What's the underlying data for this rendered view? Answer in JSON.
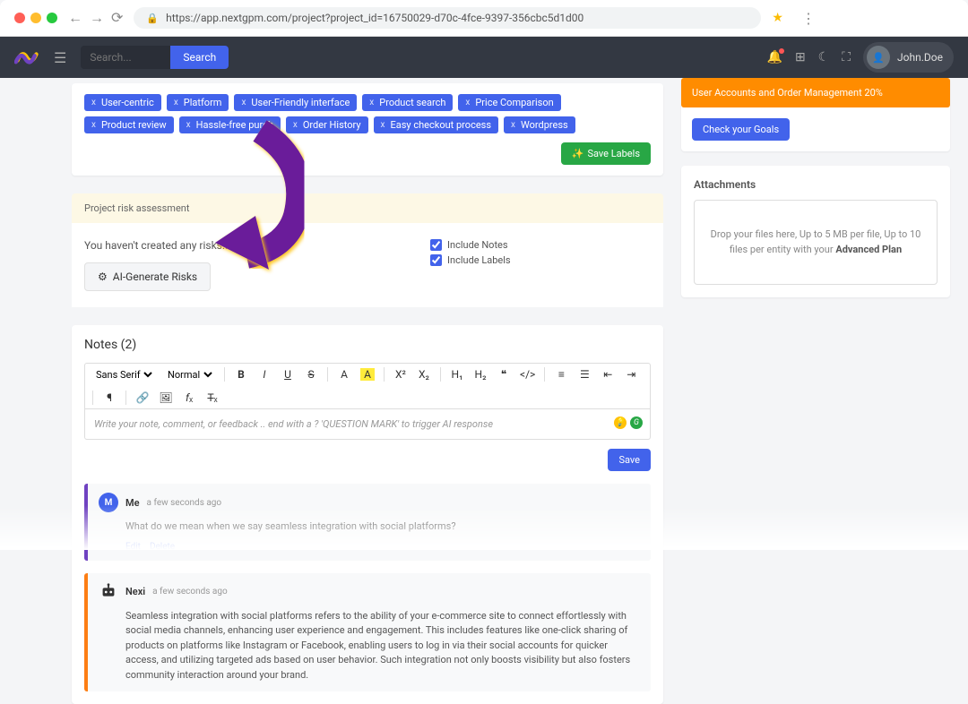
{
  "browser": {
    "url": "https://app.nextgpm.com/project?project_id=16750029-d70c-4fce-9397-356cbc5d1d00"
  },
  "nav": {
    "search_placeholder": "Search...",
    "search_btn": "Search",
    "username": "John.Doe"
  },
  "labels": {
    "chips": [
      "User-centric",
      "Platform",
      "User-Friendly interface",
      "Product search",
      "Price Comparison",
      "Product review",
      "Hassle-free purch",
      "Order History",
      "Easy checkout process",
      "Wordpress"
    ],
    "save_btn": "Save Labels"
  },
  "risk": {
    "banner": "Project risk assessment",
    "empty": "You haven't created any risks...",
    "ai_btn": "AI-Generate Risks",
    "include_notes": "Include Notes",
    "include_labels": "Include Labels"
  },
  "notes": {
    "title": "Notes (2)",
    "font_family": "Sans Serif",
    "font_style": "Normal",
    "placeholder": "Write your note, comment, or feedback .. end with a ? 'QUESTION MARK' to trigger AI response",
    "save_btn": "Save",
    "items": [
      {
        "author": "Me",
        "time": "a few seconds ago",
        "body": "What do we mean when we say seamless integration with social platforms?",
        "actions": [
          "Edit",
          "Delete"
        ]
      },
      {
        "author": "Nexi",
        "time": "a few seconds ago",
        "body": "Seamless integration with social platforms refers to the ability of your e-commerce site to connect effortlessly with social media channels, enhancing user experience and engagement. This includes features like one-click sharing of products on platforms like Instagram or Facebook, enabling users to log in via their social accounts for quicker access, and utilizing targeted ads based on user behavior. Such integration not only boosts visibility but also fosters community interaction around your brand."
      }
    ]
  },
  "goals": {
    "bar_text": "User Accounts and Order Management 20%",
    "check_btn": "Check your Goals"
  },
  "attachments": {
    "title": "Attachments",
    "drop_pre": "Drop your files here, Up to 5 MB per file, Up to 10 files per entity with your ",
    "drop_plan": "Advanced Plan"
  }
}
